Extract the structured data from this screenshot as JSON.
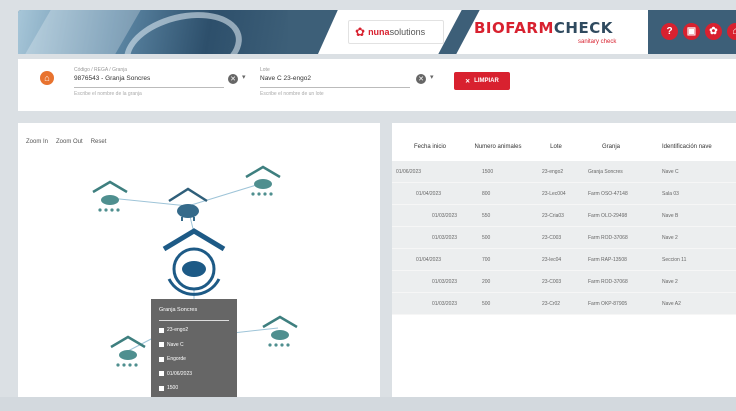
{
  "header": {
    "partner_brand": "nunasolutions",
    "partner_brand_bold": "nuna",
    "partner_brand_rest": "solutions",
    "app_brand_bio": "BIOFARM",
    "app_brand_check": "CHECK",
    "app_brand_sub": "sanitary check",
    "icons": [
      "help-icon",
      "document-icon",
      "settings-icon",
      "home-icon"
    ],
    "icon_glyphs": [
      "?",
      "▣",
      "✿",
      "⌂"
    ],
    "accent_color": "#d8212f",
    "header_color": "#3d5f78"
  },
  "filters": {
    "farm_field": {
      "label": "Código / REGA / Granja",
      "value": "9876543 - Granja Soncres",
      "hint": "Escribe el nombre de la granja"
    },
    "batch_field": {
      "label": "Lote",
      "value": "Nave C 23-engo2",
      "hint": "Escribe el nombre de un lote"
    },
    "clear_button": "LIMPIAR",
    "clear_glyph": "✕",
    "dropdown_glyph": "▾"
  },
  "graph": {
    "zoom_in": "Zoom In",
    "zoom_out": "Zoom Out",
    "reset": "Reset",
    "tooltip": {
      "title": "Granja Soncres",
      "rows": [
        {
          "icon": "batch-icon",
          "text": "23-engo2"
        },
        {
          "icon": "barn-icon",
          "text": "Nave C"
        },
        {
          "icon": "pig-icon",
          "text": "Engorde"
        },
        {
          "icon": "calendar-icon",
          "text": "01/06/2023"
        },
        {
          "icon": "animals-icon",
          "text": "1500"
        }
      ]
    }
  },
  "table": {
    "columns": [
      "Fecha inicio",
      "Numero animales",
      "Lote",
      "Granja",
      "Identificación nave"
    ],
    "rows": [
      {
        "level": 0,
        "fecha": "01/06/2023",
        "animales": "1500",
        "lote": "23-engo2",
        "granja": "Granja Soncres",
        "nave": "Nave C"
      },
      {
        "level": 1,
        "fecha": "01/04/2023",
        "animales": "800",
        "lote": "23-Lec004",
        "granja": "Farm OSO-47148",
        "nave": "Sala 03"
      },
      {
        "level": 2,
        "fecha": "01/03/2023",
        "animales": "550",
        "lote": "23-Cria03",
        "granja": "Farm OLO-29498",
        "nave": "Nave B"
      },
      {
        "level": 2,
        "fecha": "01/03/2023",
        "animales": "500",
        "lote": "23-C003",
        "granja": "Farm ROD-37068",
        "nave": "Nave 2"
      },
      {
        "level": 1,
        "fecha": "01/04/2023",
        "animales": "700",
        "lote": "23-lec04",
        "granja": "Farm RAP-13508",
        "nave": "Seccion 11"
      },
      {
        "level": 2,
        "fecha": "01/03/2023",
        "animales": "200",
        "lote": "23-C003",
        "granja": "Farm ROD-37068",
        "nave": "Nave 2"
      },
      {
        "level": 2,
        "fecha": "01/03/2023",
        "animales": "500",
        "lote": "23-Cr02",
        "granja": "Farm OKP-87905",
        "nave": "Nave A2"
      }
    ]
  }
}
